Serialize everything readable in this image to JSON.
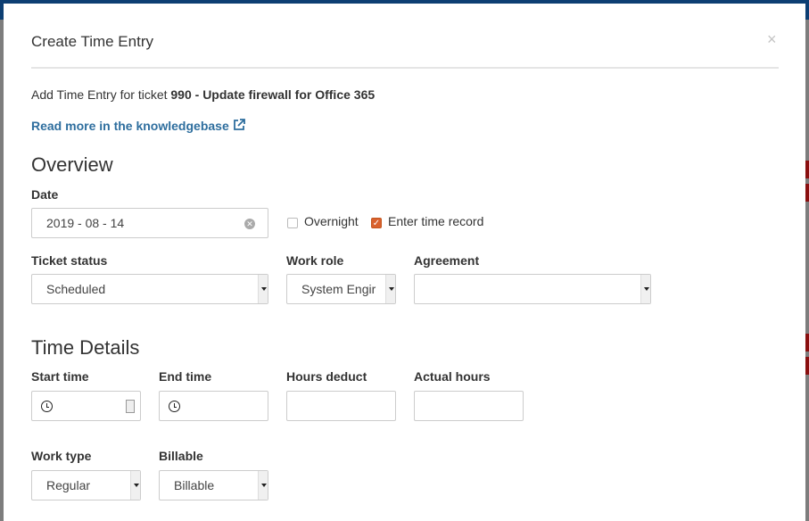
{
  "modal": {
    "title": "Create Time Entry",
    "close": "×",
    "intro_prefix": "Add Time Entry for ticket ",
    "ticket": "990 - Update firewall for Office 365",
    "kb_link": "Read more in the knowledgebase",
    "kb_icon": "external-link-icon"
  },
  "overview": {
    "heading": "Overview",
    "date_label": "Date",
    "date_value": "2019 - 08 - 14",
    "overnight_label": "Overnight",
    "overnight_checked": false,
    "enter_time_label": "Enter time record",
    "enter_time_checked": true,
    "ticket_status_label": "Ticket status",
    "ticket_status_value": "Scheduled",
    "work_role_label": "Work role",
    "work_role_value": "System Engir",
    "agreement_label": "Agreement",
    "agreement_value": ""
  },
  "time_details": {
    "heading": "Time Details",
    "start_label": "Start time",
    "end_label": "End time",
    "hours_deduct_label": "Hours deduct",
    "actual_hours_label": "Actual hours",
    "work_type_label": "Work type",
    "work_type_value": "Regular",
    "billable_label": "Billable",
    "billable_value": "Billable"
  },
  "colors": {
    "accent": "#d9612e",
    "link": "#2e6e9e",
    "backdrop_header": "#0d3f73"
  }
}
